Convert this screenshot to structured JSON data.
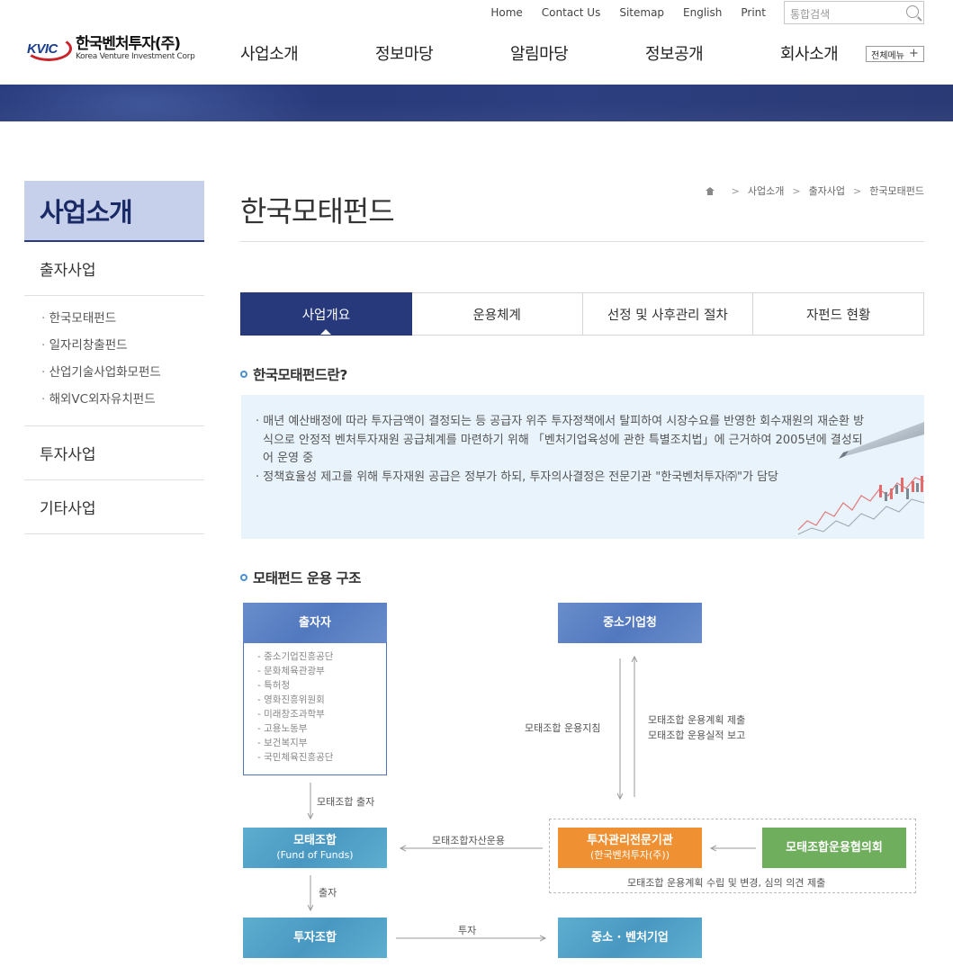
{
  "util": {
    "links": [
      "Home",
      "Contact Us",
      "Sitemap",
      "English",
      "Print"
    ],
    "search_placeholder": "통합검색"
  },
  "logo": {
    "mark": "KVIC",
    "ko": "한국벤처투자(주)",
    "en": "Korea Venture Investment Corp"
  },
  "gnb": [
    "사업소개",
    "정보마당",
    "알림마당",
    "정보공개",
    "회사소개"
  ],
  "allmenu": "전체메뉴",
  "lnb": {
    "title": "사업소개",
    "items": [
      "출자사업",
      "투자사업",
      "기타사업"
    ],
    "sub": [
      "한국모태펀드",
      "일자리창출펀드",
      "산업기술사업화모펀드",
      "해외VC외자유치펀드"
    ]
  },
  "page_title": "한국모태펀드",
  "breadcrumb": [
    "사업소개",
    "출자사업",
    "한국모태펀드"
  ],
  "tabs": [
    "사업개요",
    "운용체계",
    "선정 및 사후관리 절차",
    "자펀드 현황"
  ],
  "section1": {
    "title": "한국모태펀드란?",
    "bullets": [
      "매년 예산배정에 따라 투자금액이 결정되는 등 공급자 위주 투자정책에서 탈피하여 시장수요를 반영한 회수재원의 재순환 방식으로 안정적 벤처투자재원 공급체계를 마련하기 위해 「벤처기업육성에 관한 특별조치법」에 근거하여 2005년에 결성되어 운영 중",
      "정책효율성 제고를 위해 투자재원 공급은 정부가 하되, 투자의사결정은 전문기관 \"한국벤처투자㈜\"가 담당"
    ]
  },
  "section2": {
    "title": "모태펀드 운용 구조",
    "boxes": {
      "investor": "출자자",
      "smba": "중소기업청",
      "fof": "모태조합",
      "fof_sub": "(Fund of Funds)",
      "manager": "투자관리전문기관",
      "manager_sub": "(한국벤처투자(주))",
      "council": "모태조합운용협의회",
      "fund": "투자조합",
      "sme": "중소 · 벤처기업"
    },
    "investors": [
      "중소기업진흥공단",
      "문화체육관광부",
      "특허청",
      "영화진흥위원회",
      "미래창조과학부",
      "고용노동부",
      "보건복지부",
      "국민체육진흥공단"
    ],
    "labels": {
      "guideline": "모태조합 운용지침",
      "plan1": "모태조합 운용계획 제출",
      "plan2": "모태조합 운용실적 보고",
      "contribution": "모태조합 출자",
      "asset_mgmt": "모태조합자산운용",
      "council_note": "모태조합 운용계획 수립 및 변경, 심의 의견 제출",
      "invest_out": "출자",
      "invest": "투자"
    }
  }
}
